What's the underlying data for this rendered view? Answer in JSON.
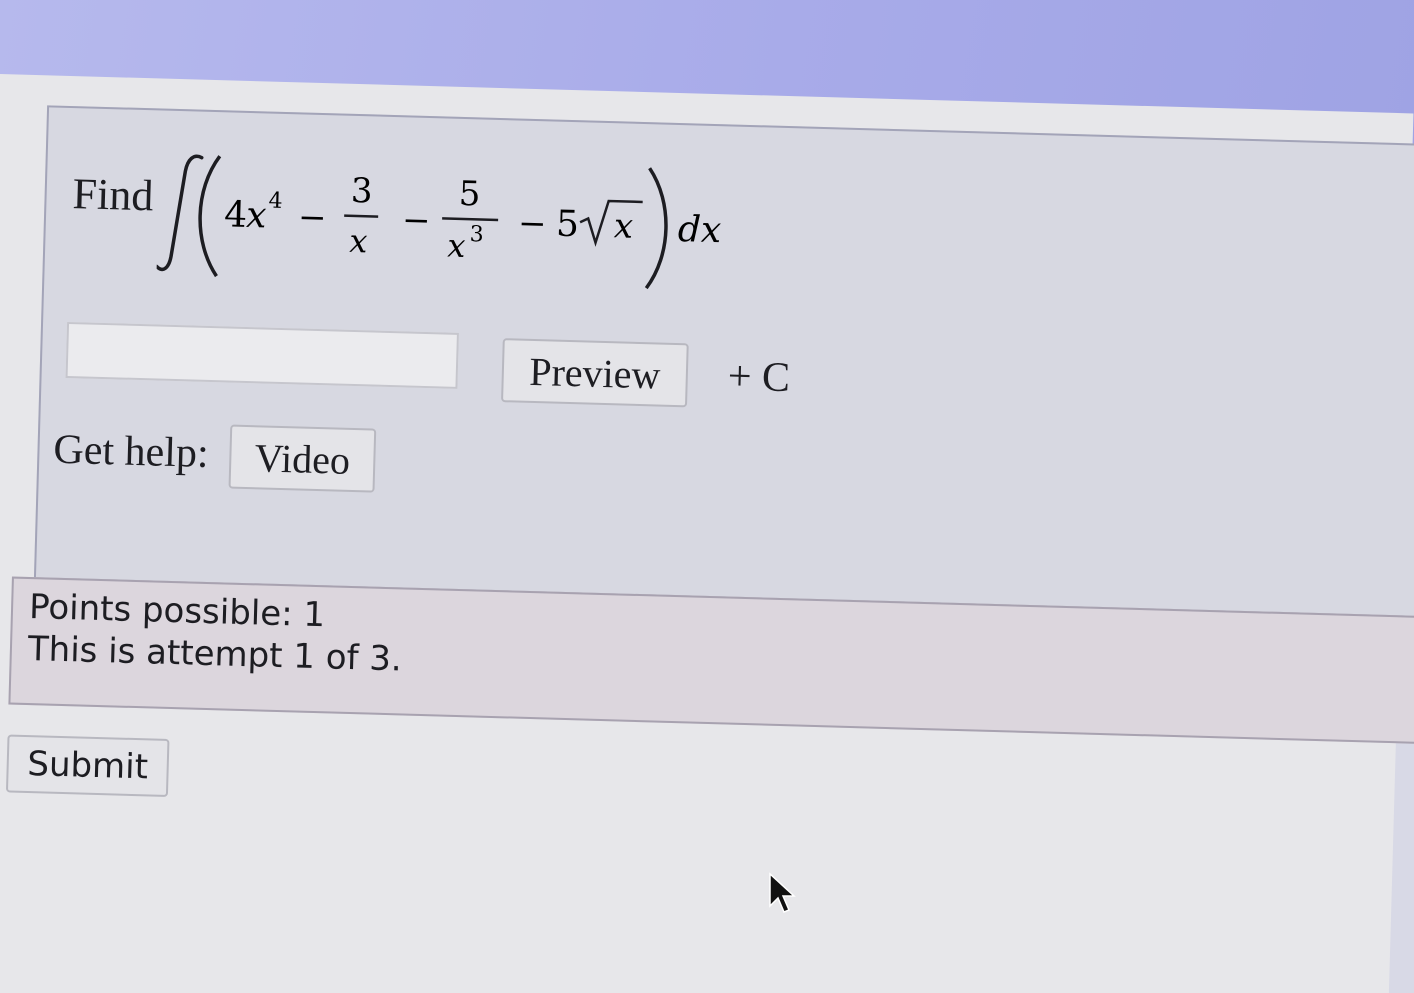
{
  "question": {
    "find_label": "Find",
    "integrand": {
      "term1_coef": "4",
      "term1_var": "x",
      "term1_exp": "4",
      "op1": "−",
      "frac1_num": "3",
      "frac1_den": "x",
      "op2": "−",
      "frac2_num": "5",
      "frac2_den_var": "x",
      "frac2_den_exp": "3",
      "op3": "−",
      "term4_coef": "5",
      "term4_radicand": "x",
      "differential": "dx"
    }
  },
  "answer": {
    "input_value": "",
    "input_placeholder": "",
    "preview_label": "Preview",
    "constant_label": "+ C"
  },
  "help": {
    "label": "Get help:",
    "video_label": "Video"
  },
  "status": {
    "points_text": "Points possible: 1",
    "attempt_text": "This is attempt 1 of 3."
  },
  "actions": {
    "submit_label": "Submit"
  },
  "colors": {
    "header_band": "#a8abe9",
    "card_background": "#d7d8e1",
    "status_background": "#dcd6dd",
    "button_background": "#e4e4e8"
  }
}
